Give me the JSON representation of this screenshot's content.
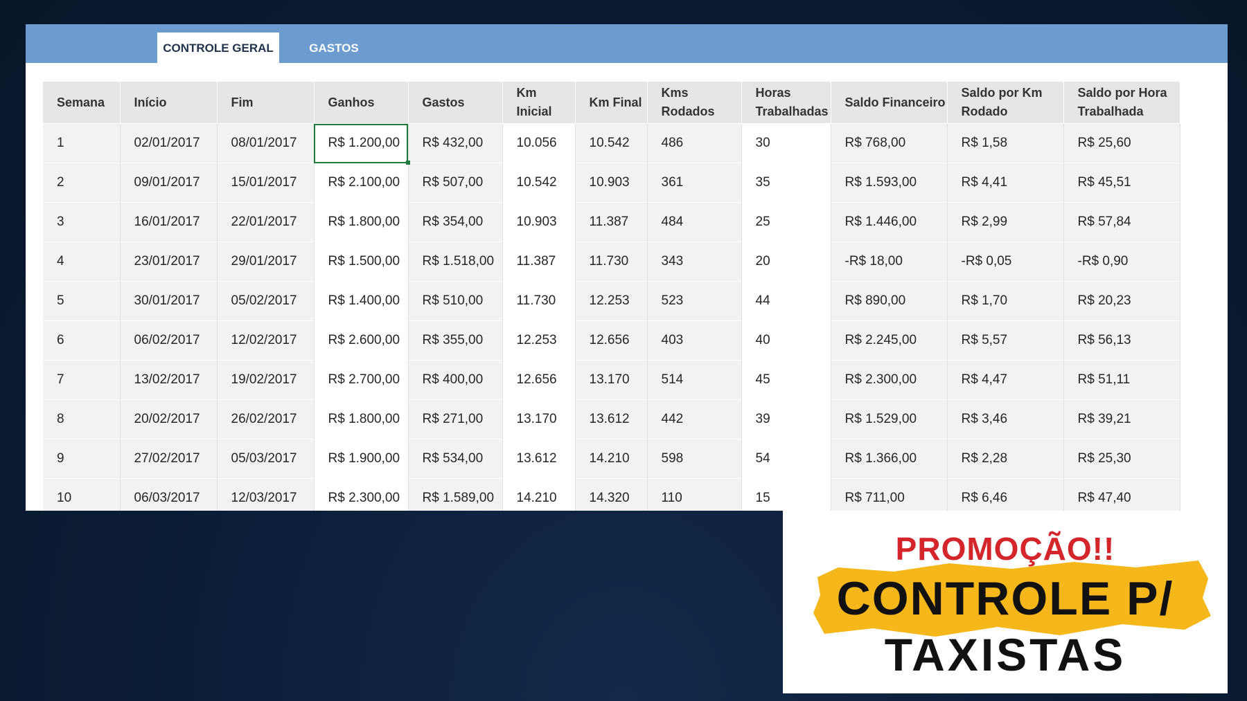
{
  "tabs": {
    "active": "CONTROLE GERAL",
    "other": "GASTOS"
  },
  "table": {
    "headers": [
      "Semana",
      "Início",
      "Fim",
      "Ganhos",
      "Gastos",
      "Km Inicial",
      "Km Final",
      "Kms Rodados",
      "Horas Trabalhadas",
      "Saldo Financeiro",
      "Saldo por Km Rodado",
      "Saldo por Hora Trabalhada"
    ],
    "rows": [
      [
        "1",
        "02/01/2017",
        "08/01/2017",
        "R$ 1.200,00",
        "R$ 432,00",
        "10.056",
        "10.542",
        "486",
        "30",
        "R$ 768,00",
        "R$ 1,58",
        "R$ 25,60"
      ],
      [
        "2",
        "09/01/2017",
        "15/01/2017",
        "R$ 2.100,00",
        "R$ 507,00",
        "10.542",
        "10.903",
        "361",
        "35",
        "R$ 1.593,00",
        "R$ 4,41",
        "R$ 45,51"
      ],
      [
        "3",
        "16/01/2017",
        "22/01/2017",
        "R$ 1.800,00",
        "R$ 354,00",
        "10.903",
        "11.387",
        "484",
        "25",
        "R$ 1.446,00",
        "R$ 2,99",
        "R$ 57,84"
      ],
      [
        "4",
        "23/01/2017",
        "29/01/2017",
        "R$ 1.500,00",
        "R$ 1.518,00",
        "11.387",
        "11.730",
        "343",
        "20",
        "-R$ 18,00",
        "-R$ 0,05",
        "-R$ 0,90"
      ],
      [
        "5",
        "30/01/2017",
        "05/02/2017",
        "R$ 1.400,00",
        "R$ 510,00",
        "11.730",
        "12.253",
        "523",
        "44",
        "R$ 890,00",
        "R$ 1,70",
        "R$ 20,23"
      ],
      [
        "6",
        "06/02/2017",
        "12/02/2017",
        "R$ 2.600,00",
        "R$ 355,00",
        "12.253",
        "12.656",
        "403",
        "40",
        "R$ 2.245,00",
        "R$ 5,57",
        "R$ 56,13"
      ],
      [
        "7",
        "13/02/2017",
        "19/02/2017",
        "R$ 2.700,00",
        "R$ 400,00",
        "12.656",
        "13.170",
        "514",
        "45",
        "R$ 2.300,00",
        "R$ 4,47",
        "R$ 51,11"
      ],
      [
        "8",
        "20/02/2017",
        "26/02/2017",
        "R$ 1.800,00",
        "R$ 271,00",
        "13.170",
        "13.612",
        "442",
        "39",
        "R$ 1.529,00",
        "R$ 3,46",
        "R$ 39,21"
      ],
      [
        "9",
        "27/02/2017",
        "05/03/2017",
        "R$ 1.900,00",
        "R$ 534,00",
        "13.612",
        "14.210",
        "598",
        "54",
        "R$ 1.366,00",
        "R$ 2,28",
        "R$ 25,30"
      ],
      [
        "10",
        "06/03/2017",
        "12/03/2017",
        "R$ 2.300,00",
        "R$ 1.589,00",
        "14.210",
        "14.320",
        "110",
        "15",
        "R$ 711,00",
        "R$ 6,46",
        "R$ 47,40"
      ]
    ]
  },
  "promo": {
    "title": "PROMOÇÃO!!",
    "line1": "CONTROLE P/",
    "line2": "TAXISTAS"
  },
  "colors": {
    "tabbar": "#6c9bcf",
    "background": "#0b1c35",
    "promo_red": "#d4252b",
    "promo_yellow": "#f6b71a",
    "selection": "#1f7a3f"
  }
}
